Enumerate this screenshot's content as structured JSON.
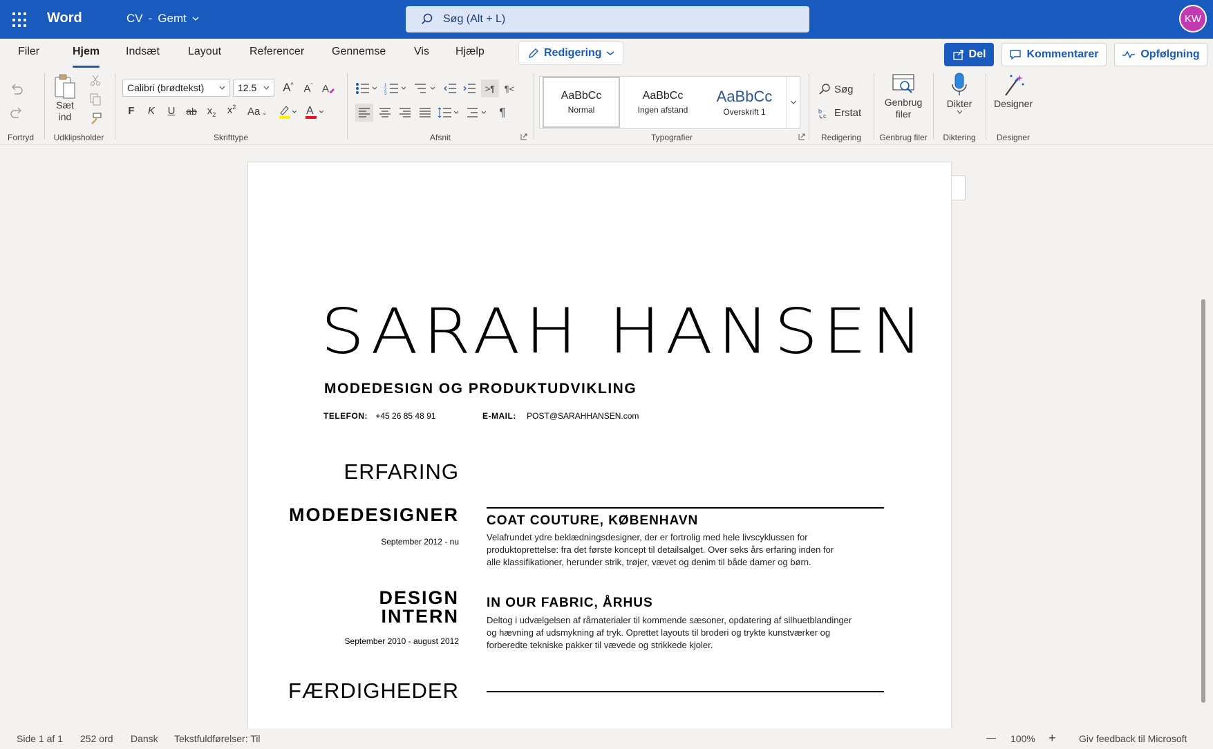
{
  "titlebar": {
    "app_name": "Word",
    "doc_name": "CV",
    "doc_sep": "-",
    "doc_status": "Gemt",
    "search_placeholder": "Søg (Alt + L)",
    "avatar_initials": "KW",
    "bg_color": "#185abd"
  },
  "menu": {
    "tabs": [
      "Filer",
      "Hjem",
      "Indsæt",
      "Layout",
      "Referencer",
      "Gennemse",
      "Vis",
      "Hjælp"
    ],
    "active_tab": "Hjem",
    "edit_mode": "Redigering",
    "share": "Del",
    "comments": "Kommentarer",
    "follow_up": "Opfølgning"
  },
  "ribbon": {
    "groups": {
      "undo": "Fortryd",
      "clipboard": "Udklipsholder",
      "font": "Skrifttype",
      "paragraph": "Afsnit",
      "styles": "Typografier",
      "editing": "Redigering",
      "reuse": "Genbrug filer",
      "dictation": "Diktering",
      "designer": "Designer"
    },
    "paste_label_1": "Sæt",
    "paste_label_2": "ind",
    "font_name": "Calibri (brødtekst)",
    "font_size": "12.5",
    "format_buttons": {
      "bold": "F",
      "italic": "K",
      "underline": "U",
      "strike": "ab",
      "change_case": "Aa"
    },
    "styles": [
      {
        "sample": "AaBbCc",
        "name": "Normal"
      },
      {
        "sample": "AaBbCc",
        "name": "Ingen afstand"
      },
      {
        "sample": "AaBbCc",
        "name": "Overskrift 1"
      }
    ],
    "find": "Søg",
    "replace": "Erstat",
    "reuse_1": "Genbrug",
    "reuse_2": "filer",
    "dictate": "Dikter",
    "designer": "Designer"
  },
  "document": {
    "name": "SARAH HANSEN",
    "subtitle": "MODEDESIGN OG PRODUKTUDVIKLING",
    "phone_label": "TELEFON:",
    "phone": "+45 26 85 48 91",
    "email_label": "E-MAIL:",
    "email": "POST@SARAHHANSEN.com",
    "experience_heading": "ERFARING",
    "jobs": [
      {
        "role": "MODEDESIGNER",
        "dates": "September 2012 - nu",
        "company": "COAT COUTURE, KØBENHAVN",
        "desc_lines": [
          "Velafrundet ydre beklædningsdesigner, der er fortrolig med hele livscyklussen for",
          "produktoprettelse: fra det første koncept til detailsalget. Over seks års erfaring inden for",
          "alle klassifikationer, herunder strik, trøjer, vævet og denim til både damer og børn."
        ]
      },
      {
        "role_line_1": "DESIGN",
        "role_line_2": "INTERN",
        "dates": "September 2010 - august 2012",
        "company": "IN OUR FABRIC, ÅRHUS",
        "desc_lines": [
          "Deltog i udvælgelsen af råmaterialer til kommende sæsoner, opdatering af silhuetblandinger",
          "og hævning af udsmykning af tryk. Oprettet layouts til broderi og trykte kunstværker og",
          "forberedte tekniske pakker til vævede og strikkede kjoler."
        ]
      }
    ],
    "skills_heading": "FÆRDIGHEDER"
  },
  "statusbar": {
    "page": "Side 1 af 1",
    "words": "252 ord",
    "language": "Dansk",
    "predictions": "Tekstfuldførelser: Til",
    "zoom_out": "—",
    "zoom": "100%",
    "zoom_in": "+",
    "feedback": "Giv feedback til Microsoft"
  }
}
